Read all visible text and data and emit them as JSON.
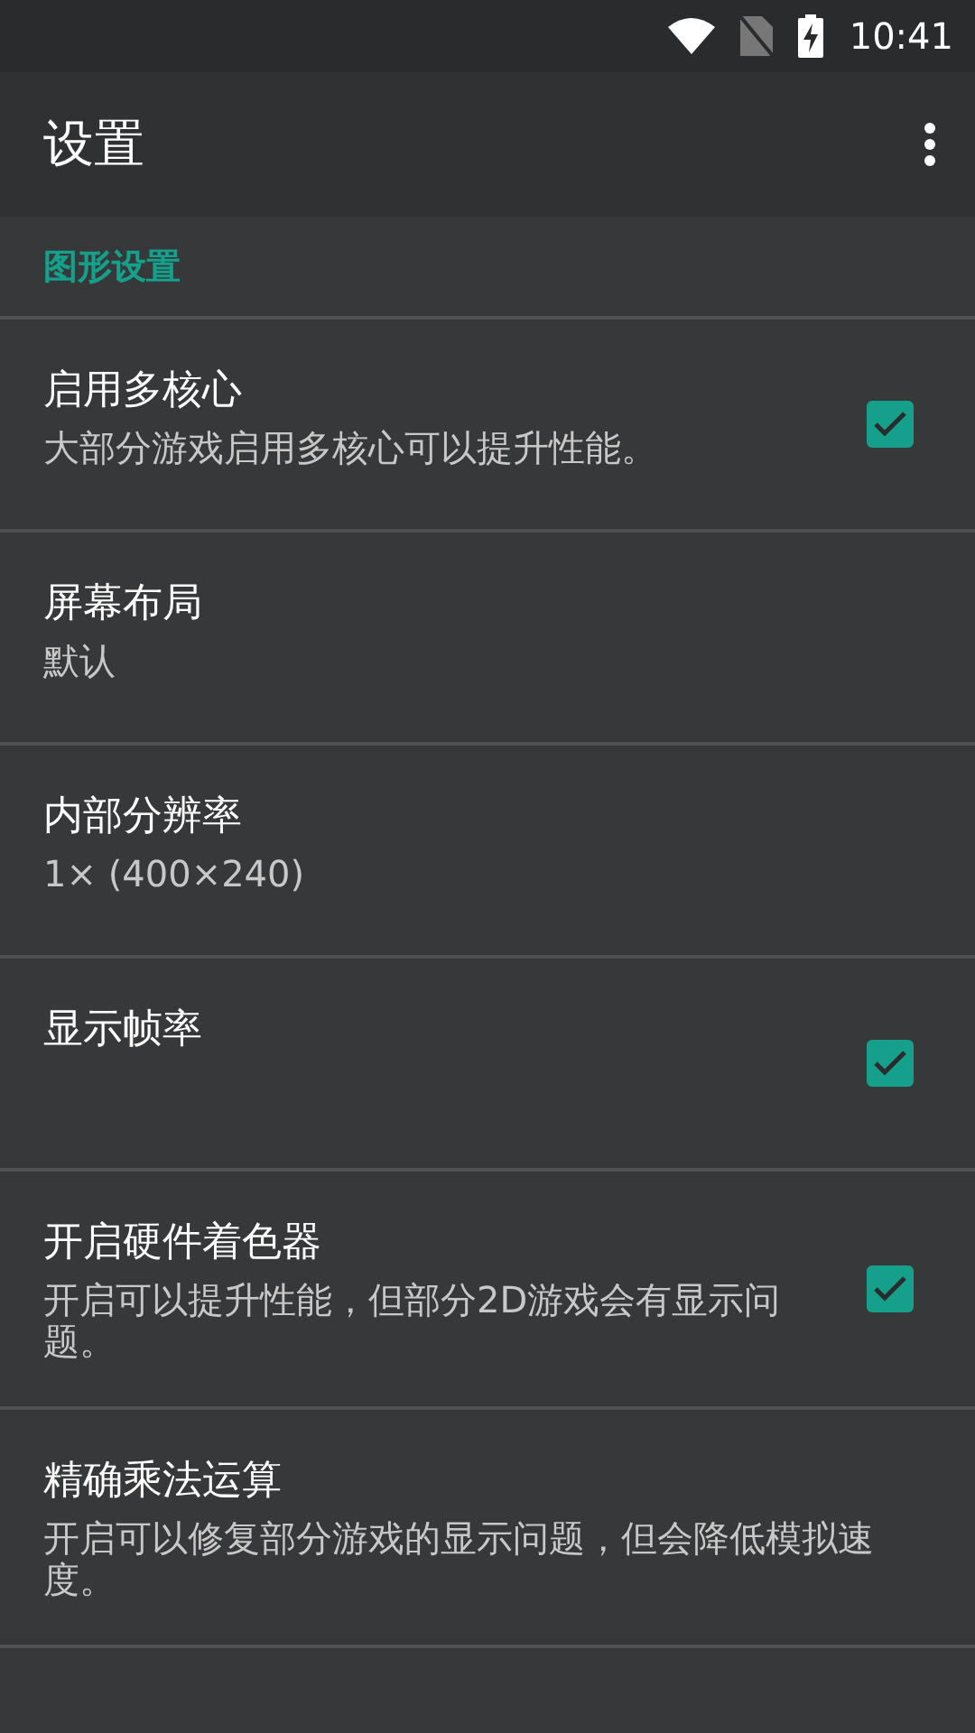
{
  "status_bar": {
    "time": "10:41"
  },
  "app_bar": {
    "title": "设置"
  },
  "section": {
    "title": "图形设置"
  },
  "settings": [
    {
      "kind": "checkbox",
      "title": "启用多核心",
      "summary": "大部分游戏启用多核心可以提升性能。",
      "checked": true
    },
    {
      "kind": "value",
      "title": "屏幕布局",
      "summary": "默认"
    },
    {
      "kind": "value",
      "title": "内部分辨率",
      "summary": "1× (400×240)"
    },
    {
      "kind": "checkbox",
      "title": "显示帧率",
      "checked": true
    },
    {
      "kind": "checkbox",
      "title": "开启硬件着色器",
      "summary": "开启可以提升性能，但部分2D游戏会有显示问题。",
      "checked": true
    },
    {
      "kind": "value",
      "title": "精确乘法运算",
      "summary": "开启可以修复部分游戏的显示问题，但会降低模拟速度。"
    }
  ]
}
